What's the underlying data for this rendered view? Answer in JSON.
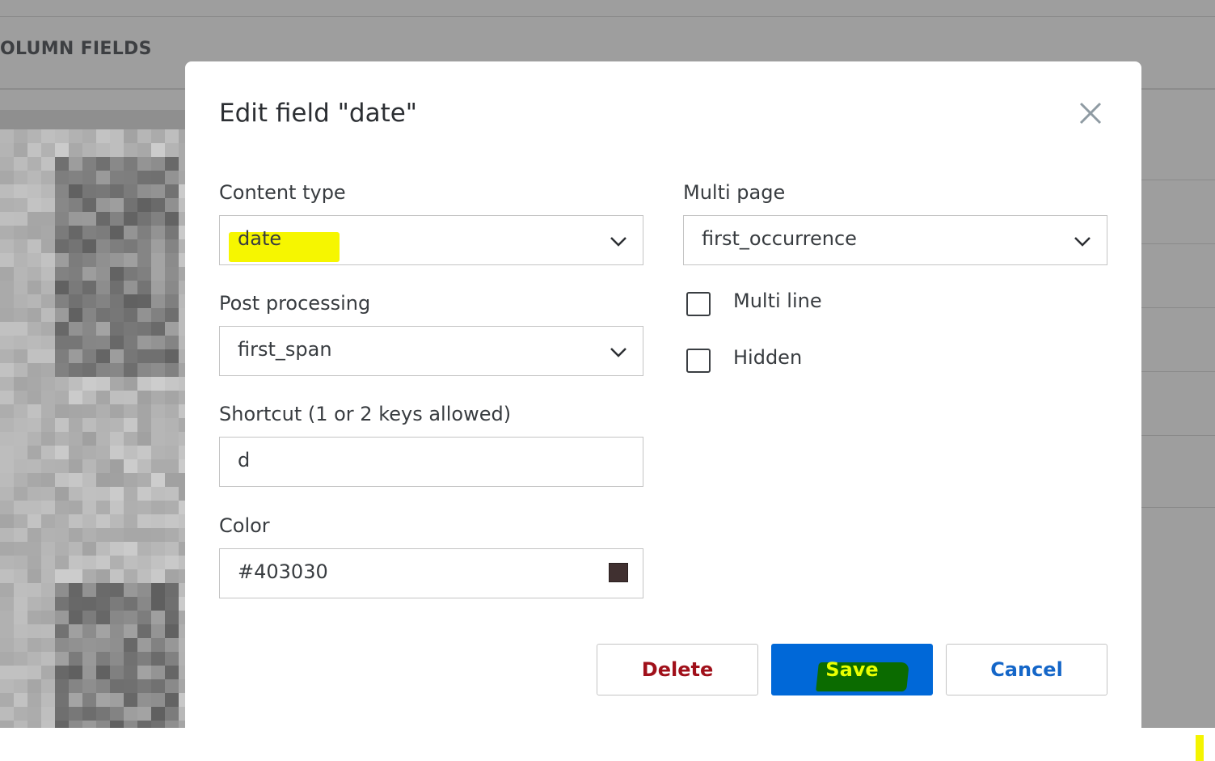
{
  "background": {
    "section_header": "OLUMN FIELDS"
  },
  "dialog": {
    "title": "Edit field \"date\"",
    "close_icon": "close-icon",
    "content_type": {
      "label": "Content type",
      "value": "date"
    },
    "post_processing": {
      "label": "Post processing",
      "value": "first_span"
    },
    "shortcut": {
      "label": "Shortcut (1 or 2 keys allowed)",
      "value": "d"
    },
    "color": {
      "label": "Color",
      "value": "#403030",
      "swatch": "#403030"
    },
    "multi_page": {
      "label": "Multi page",
      "value": "first_occurrence"
    },
    "multi_line": {
      "label": "Multi line",
      "checked": false
    },
    "hidden": {
      "label": "Hidden",
      "checked": false
    },
    "buttons": {
      "delete": "Delete",
      "save": "Save",
      "cancel": "Cancel"
    }
  },
  "colors": {
    "primary": "#0068d8",
    "danger": "#a0101a",
    "link": "#1466c8",
    "highlight": "#f6f600"
  }
}
